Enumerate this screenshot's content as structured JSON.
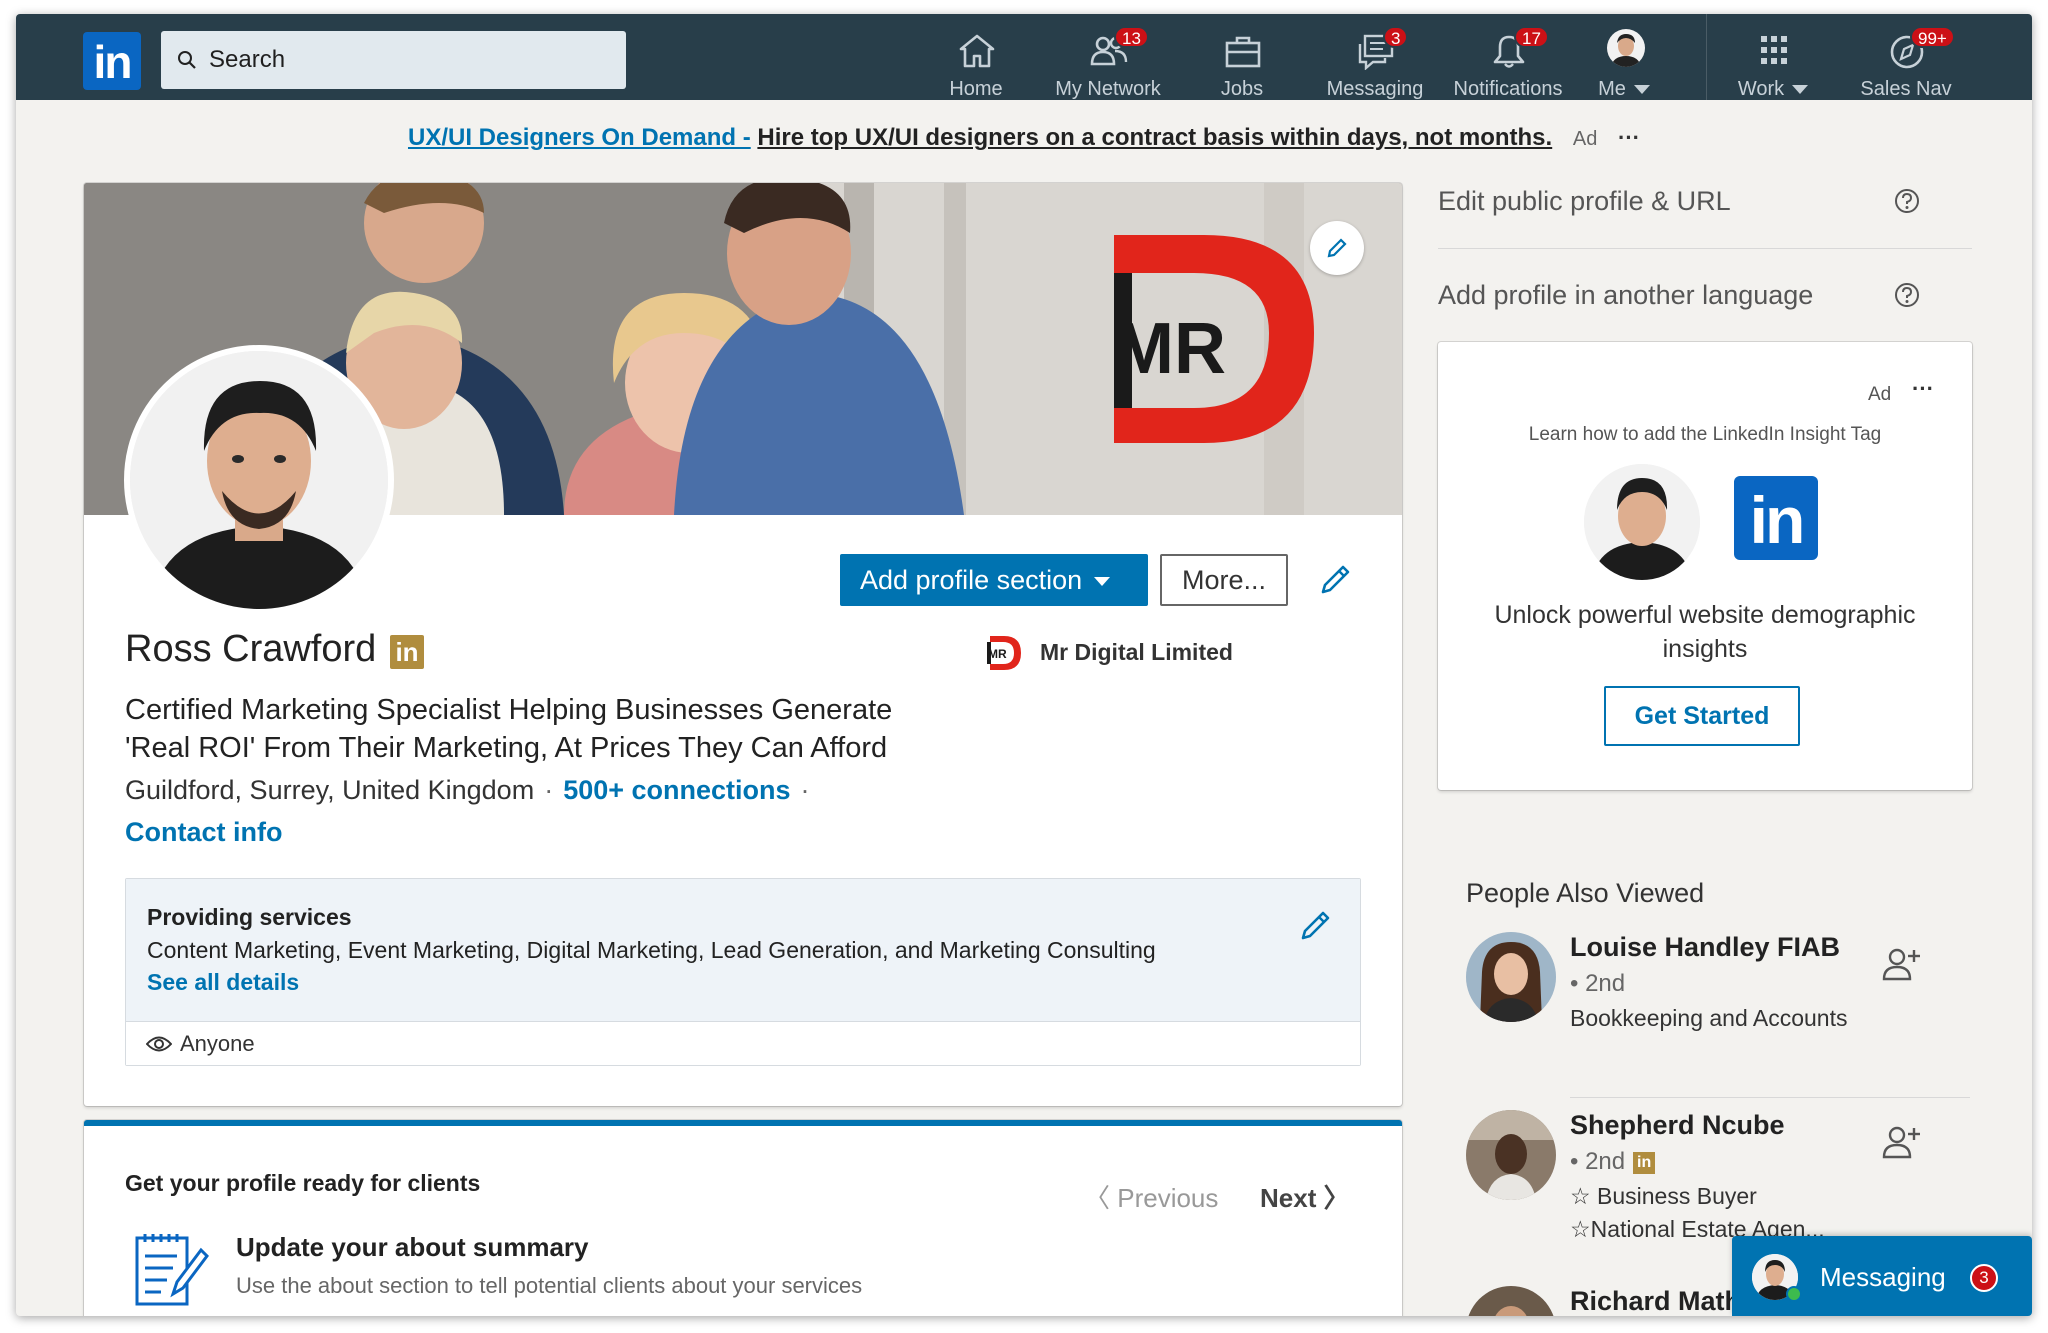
{
  "nav": {
    "search_placeholder": "Search",
    "items": [
      {
        "label": "Home",
        "icon": "home-icon",
        "badge": ""
      },
      {
        "label": "My Network",
        "icon": "network-icon",
        "badge": "13"
      },
      {
        "label": "Jobs",
        "icon": "briefcase-icon",
        "badge": ""
      },
      {
        "label": "Messaging",
        "icon": "messaging-icon",
        "badge": "3"
      },
      {
        "label": "Notifications",
        "icon": "bell-icon",
        "badge": "17"
      },
      {
        "label": "Me",
        "icon": "avatar",
        "badge": ""
      },
      {
        "label": "Work",
        "icon": "grid-icon",
        "badge": ""
      },
      {
        "label": "Sales Nav",
        "icon": "compass-icon",
        "badge": "99+"
      }
    ],
    "brand_color": "#283e4a",
    "badge_color": "#cc1016"
  },
  "ad_banner": {
    "link_text": "UX/UI Designers On Demand -",
    "text": "Hire top UX/UI designers on a contract basis within days, not months.",
    "ad_label": "Ad",
    "more": "···"
  },
  "profile": {
    "cover_logo_text": "MR",
    "name": "Ross Crawford",
    "premium_badge": "in",
    "company": "Mr Digital Limited",
    "headline": "Certified Marketing Specialist Helping Businesses Generate 'Real ROI' From Their Marketing, At Prices They Can Afford",
    "location": "Guildford, Surrey, United Kingdom",
    "connections": "500+ connections",
    "contact_info": "Contact info",
    "add_section_button": "Add profile section",
    "more_button": "More...",
    "accent_color": "#0073b1"
  },
  "services": {
    "title": "Providing services",
    "description": "Content Marketing, Event Marketing, Digital Marketing, Lead Generation, and Marketing Consulting",
    "see_all": "See all details",
    "visibility": "Anyone"
  },
  "ready_card": {
    "title": "Get your profile ready for clients",
    "previous": "Previous",
    "next": "Next",
    "item_title": "Update your about summary",
    "item_desc": "Use the about section to tell potential clients about your services"
  },
  "rail": {
    "edit_public": "Edit public profile & URL",
    "add_language": "Add profile in another language",
    "ad": {
      "label": "Ad",
      "more": "···",
      "small": "Learn how to add the LinkedIn Insight Tag",
      "logo": "in",
      "headline": "Unlock powerful website demographic insights",
      "cta": "Get Started"
    },
    "people_title": "People Also Viewed",
    "people": [
      {
        "name": "Louise Handley FIAB",
        "degree": "2nd",
        "title": "Bookkeeping and Accounts"
      },
      {
        "name": "Shepherd Ncube",
        "degree": "2nd",
        "title_line1": "☆ Business Buyer",
        "title_line2": "☆National Estate Agen..."
      },
      {
        "name": "Richard Math"
      }
    ]
  },
  "messaging_bar": {
    "label": "Messaging",
    "count": "3"
  }
}
